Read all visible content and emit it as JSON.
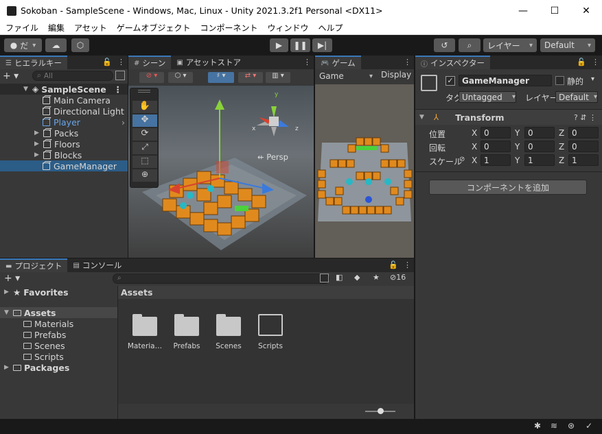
{
  "window": {
    "title": "Sokoban - SampleScene - Windows, Mac, Linux - Unity 2021.3.2f1 Personal <DX11>",
    "minimize": "—",
    "maximize": "☐",
    "close": "✕"
  },
  "menu": [
    "ファイル",
    "編集",
    "アセット",
    "ゲームオブジェクト",
    "コンポーネント",
    "ウィンドウ",
    "ヘルプ"
  ],
  "toolbar": {
    "account": "だ",
    "layers": "レイヤー",
    "layout": "Default"
  },
  "hierarchy": {
    "tab": "ヒエラルキー",
    "search_placeholder": "All",
    "scene": "SampleScene",
    "items": [
      "Main Camera",
      "Directional Light",
      "Player",
      "Packs",
      "Floors",
      "Blocks",
      "GameManager"
    ]
  },
  "scene": {
    "tab": "シーン",
    "asset_store_tab": "アセットストア",
    "persp": "Persp",
    "axis_y": "y",
    "axis_x": "x",
    "axis_z": "z"
  },
  "game": {
    "tab": "ゲーム",
    "mode": "Game",
    "display": "Display"
  },
  "project": {
    "tab": "プロジェクト",
    "console_tab": "コンソール",
    "hidden_count": "16",
    "favorites": "Favorites",
    "assets": "Assets",
    "asset_folders": [
      "Materials",
      "Prefabs",
      "Scenes",
      "Scripts"
    ],
    "packages": "Packages",
    "breadcrumb": "Assets",
    "grid": [
      "Materia…",
      "Prefabs",
      "Scenes",
      "Scripts"
    ]
  },
  "inspector": {
    "tab": "インスペクター",
    "object_name": "GameManager",
    "static_label": "静的",
    "tag_label": "タグ",
    "tag_value": "Untagged",
    "layer_label": "レイヤー",
    "layer_value": "Default",
    "transform": "Transform",
    "position_label": "位置",
    "rotation_label": "回転",
    "scale_label": "スケール",
    "position": {
      "x": "0",
      "y": "0",
      "z": "0"
    },
    "rotation": {
      "x": "0",
      "y": "0",
      "z": "0"
    },
    "scale": {
      "x": "1",
      "y": "1",
      "z": "1"
    },
    "add_component": "コンポーネントを追加"
  },
  "colors": {
    "accent": "#3a79bb",
    "selection": "#2c5d87",
    "panel": "#383838"
  }
}
